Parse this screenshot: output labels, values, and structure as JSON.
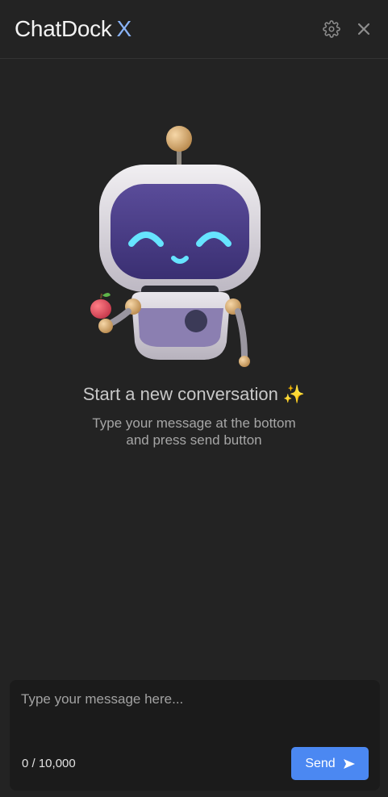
{
  "app": {
    "brand_name": "ChatDock",
    "brand_suffix": "X",
    "accent": "#8ab4f8"
  },
  "header": {
    "settings_icon": "gear-icon",
    "close_icon": "close-icon"
  },
  "empty_state": {
    "title": "Start a new conversation",
    "title_emoji": "✨",
    "line1": "Type your message at the bottom",
    "line2": "and press send button"
  },
  "composer": {
    "placeholder": "Type your message here...",
    "value": "",
    "char_count": "0 / 10,000",
    "send_label": "Send",
    "send_icon": "paper-plane-icon",
    "send_color": "#4b88f2"
  }
}
